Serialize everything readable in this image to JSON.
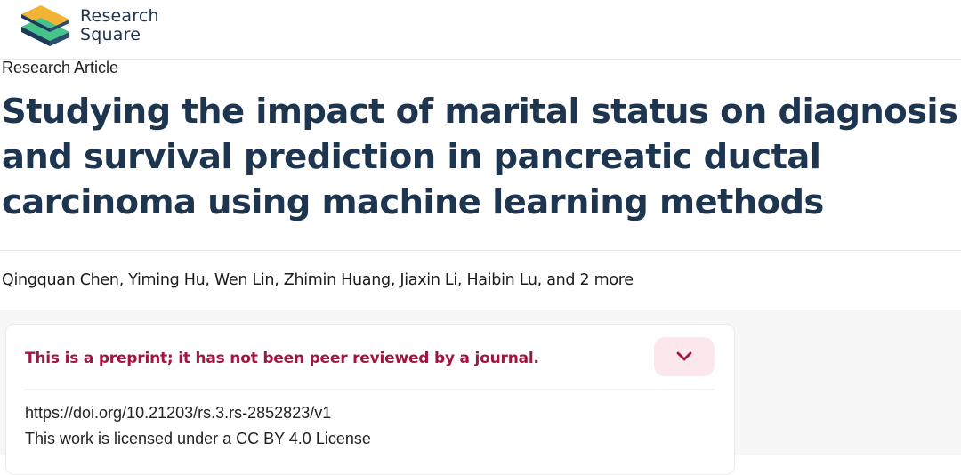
{
  "site": {
    "name_line1": "Research",
    "name_line2": "Square",
    "colors": {
      "logo_blue": "#1e3a5a",
      "logo_green": "#46c38a",
      "logo_yellow": "#f2b234"
    }
  },
  "article": {
    "type": "Research Article",
    "title": "Studying the impact of marital status on diagnosis and survival prediction in pancreatic ductal carcinoma using machine learning methods",
    "authors": [
      "Qingquan Chen",
      "Yiming Hu",
      "Wen Lin",
      "Zhimin Huang",
      "Jiaxin Li",
      "Haibin Lu"
    ],
    "authors_more": "and 2 more"
  },
  "notice": {
    "message": "This is a preprint; it has not been peer reviewed by a journal.",
    "toggle_icon": "chevron-down-icon",
    "accent_color": "#a11640",
    "doi": "https://doi.org/10.21203/rs.3.rs-2852823/v1",
    "license": "This work is licensed under a CC BY 4.0 License"
  }
}
